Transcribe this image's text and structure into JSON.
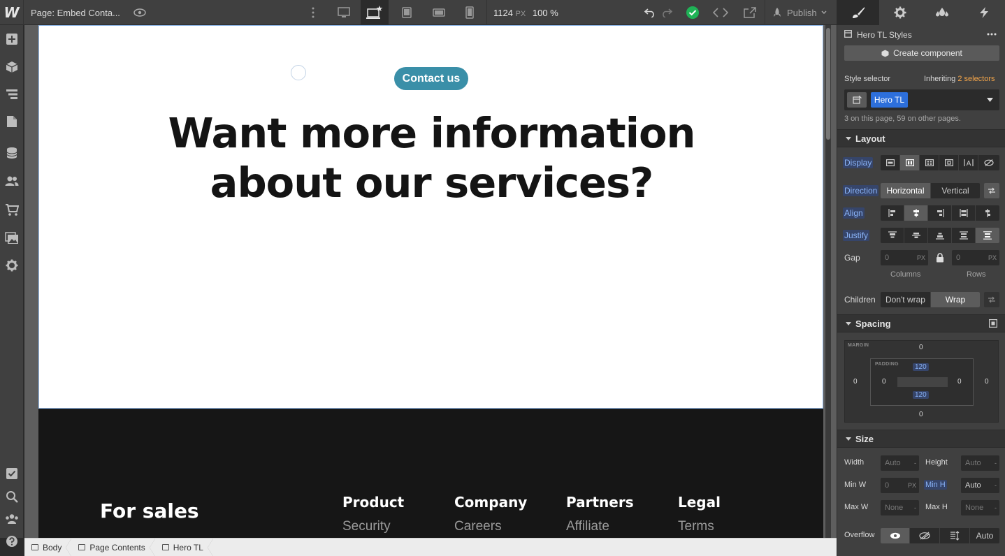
{
  "topbar": {
    "logo": "W",
    "page_label": "Page: Embed Conta...",
    "width_value": "1124",
    "width_unit": "PX",
    "zoom": "100 %",
    "publish_label": "Publish"
  },
  "canvas": {
    "contact_button": "Contact us",
    "hero_title_line1": "Want more information",
    "hero_title_line2": "about our services?",
    "footer": {
      "heading": "For sales",
      "columns": [
        {
          "title": "Product",
          "link": "Security"
        },
        {
          "title": "Company",
          "link": "Careers"
        },
        {
          "title": "Partners",
          "link": "Affiliate"
        },
        {
          "title": "Legal",
          "link": "Terms"
        }
      ]
    }
  },
  "breadcrumb": [
    "Body",
    "Page Contents",
    "Hero TL"
  ],
  "panel": {
    "element_title": "Hero TL Styles",
    "create_component": "Create component",
    "style_selector_label": "Style selector",
    "inheriting_label": "Inheriting",
    "inheriting_count": "2 selectors",
    "selector_chip": "Hero TL",
    "usage_note": "3 on this page, 59 on other pages.",
    "layout": {
      "title": "Layout",
      "display_label": "Display",
      "direction_label": "Direction",
      "direction_options": [
        "Horizontal",
        "Vertical"
      ],
      "align_label": "Align",
      "justify_label": "Justify",
      "gap_label": "Gap",
      "gap_columns": "0",
      "gap_rows": "0",
      "gap_unit": "PX",
      "columns_label": "Columns",
      "rows_label": "Rows",
      "children_label": "Children",
      "children_options": [
        "Don't wrap",
        "Wrap"
      ]
    },
    "spacing": {
      "title": "Spacing",
      "margin_label": "MARGIN",
      "padding_label": "PADDING",
      "margin_top": "0",
      "margin_bottom": "0",
      "margin_left": "0",
      "margin_right": "0",
      "padding_top": "120",
      "padding_bottom": "120",
      "padding_left": "0",
      "padding_right": "0"
    },
    "size": {
      "title": "Size",
      "width_label": "Width",
      "width_value": "Auto",
      "height_label": "Height",
      "height_value": "Auto",
      "minw_label": "Min W",
      "minw_value": "0",
      "minw_unit": "PX",
      "minh_label": "Min H",
      "minh_value": "Auto",
      "maxw_label": "Max W",
      "maxw_value": "None",
      "maxh_label": "Max H",
      "maxh_value": "None",
      "dash": "-",
      "overflow_label": "Overflow",
      "overflow_auto": "Auto"
    }
  },
  "colors": {
    "accent_blue": "#2d6fdb",
    "highlight_label": "#8ab4f8",
    "inherit_orange": "#f5a64a",
    "status_green": "#1fb256",
    "contact_pill": "#3a8fa8"
  }
}
